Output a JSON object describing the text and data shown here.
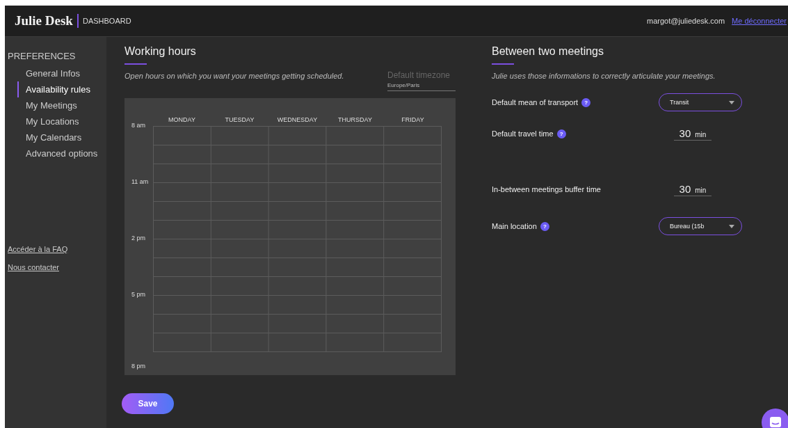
{
  "header": {
    "logo": "Julie Desk",
    "section": "DASHBOARD",
    "email": "margot@juliedesk.com",
    "logout": "Me déconnecter"
  },
  "sidebar": {
    "heading": "PREFERENCES",
    "items": [
      {
        "label": "General Infos",
        "selected": false
      },
      {
        "label": "Availability rules",
        "selected": true
      },
      {
        "label": "My Meetings",
        "selected": false
      },
      {
        "label": "My Locations",
        "selected": false
      },
      {
        "label": "My Calendars",
        "selected": false
      },
      {
        "label": "Advanced options",
        "selected": false
      }
    ],
    "links": [
      "Accéder à la FAQ",
      "Nous contacter"
    ]
  },
  "working_hours": {
    "title": "Working hours",
    "description": "Open hours on which you want your meetings getting scheduled.",
    "timezone": {
      "placeholder": "Default timezone",
      "value": "Europe/Paris"
    },
    "days": [
      "MONDAY",
      "TUESDAY",
      "WEDNESDAY",
      "THURSDAY",
      "FRIDAY"
    ],
    "times": [
      "8 am",
      "11 am",
      "2 pm",
      "5 pm",
      "8 pm"
    ]
  },
  "between_meetings": {
    "title": "Between two meetings",
    "description": "Julie uses those informations to correctly articulate your meetings.",
    "settings": [
      {
        "kind": "select",
        "label": "Default mean of transport",
        "help": "?",
        "value": "Transit"
      },
      {
        "kind": "duration",
        "label": "Default travel time",
        "help": "?",
        "value": "30",
        "unit": "min"
      },
      {
        "kind": "duration",
        "label": "In-between meetings buffer time",
        "value": "30",
        "unit": "min"
      },
      {
        "kind": "select",
        "label": "Main location",
        "help": "?",
        "value": "Bureau (15b"
      }
    ]
  },
  "save_button": "Save"
}
